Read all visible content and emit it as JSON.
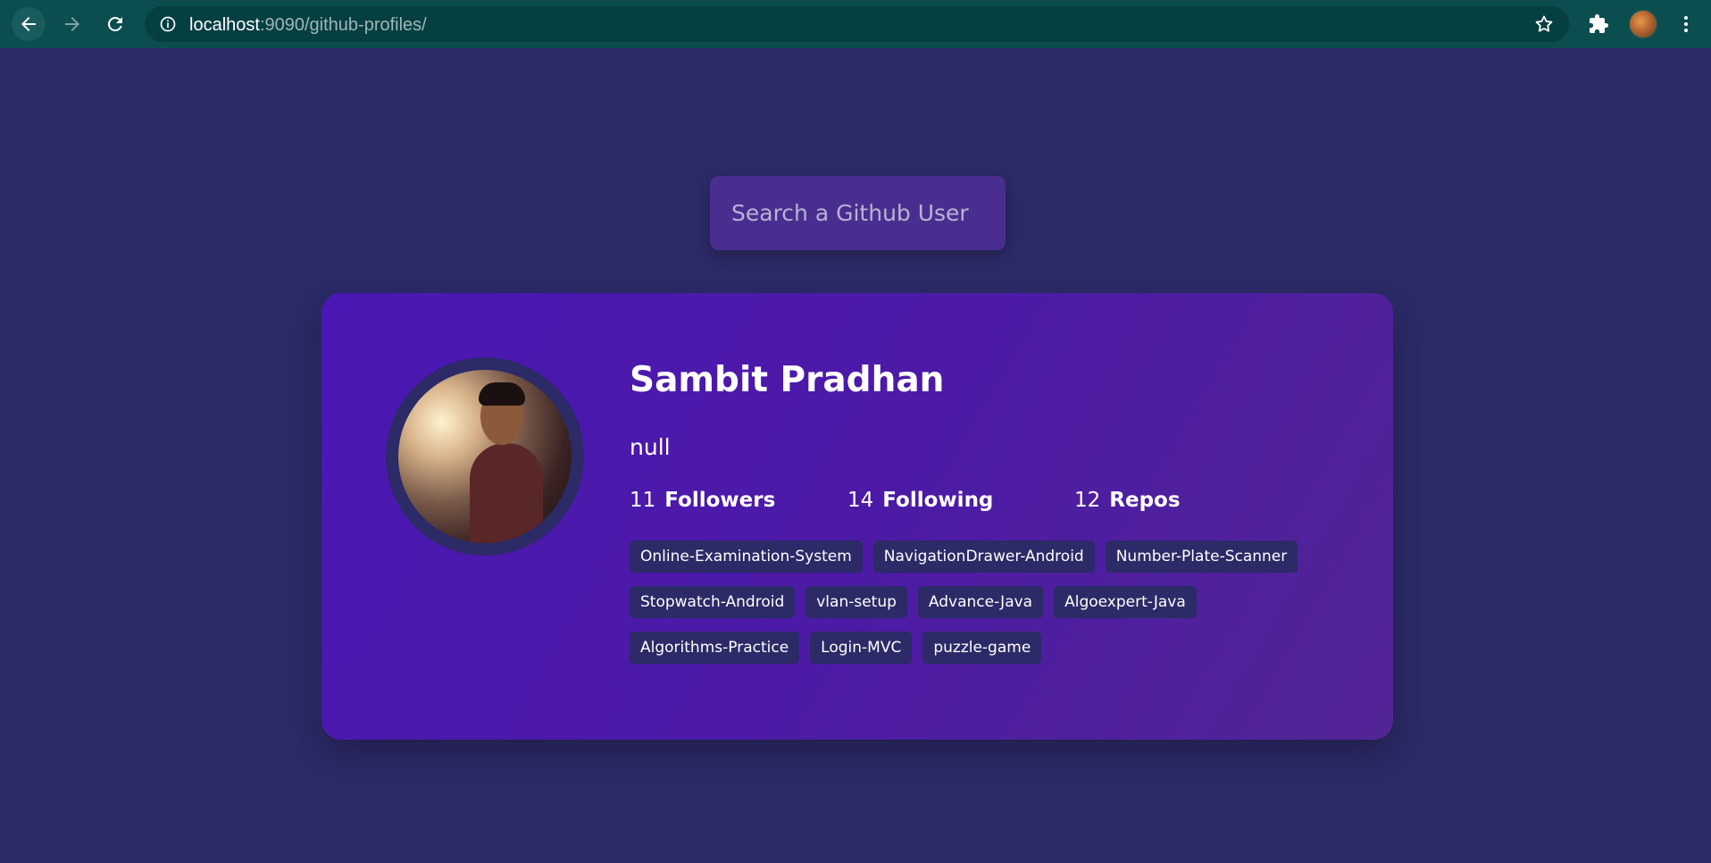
{
  "browser": {
    "url_host": "localhost",
    "url_path": ":9090/github-profiles/"
  },
  "search": {
    "placeholder": "Search a Github User",
    "value": ""
  },
  "profile": {
    "name": "Sambit Pradhan",
    "bio": "null",
    "followers_count": "11",
    "followers_label": "Followers",
    "following_count": "14",
    "following_label": "Following",
    "repos_count": "12",
    "repos_label": "Repos",
    "repos": [
      "Online-Examination-System",
      "NavigationDrawer-Android",
      "Number-Plate-Scanner",
      "Stopwatch-Android",
      "vlan-setup",
      "Advance-Java",
      "Algoexpert-Java",
      "Algorithms-Practice",
      "Login-MVC",
      "puzzle-game"
    ]
  },
  "colors": {
    "page_background": "#2c2a67",
    "card_gradient_start": "#4a17b4",
    "card_gradient_end": "#522596",
    "tag_background": "#2c2a67",
    "search_background": "#4a2e8f",
    "browser_toolbar": "#0c4d4f"
  },
  "icons": [
    "back-arrow-icon",
    "forward-arrow-icon",
    "reload-icon",
    "info-icon",
    "star-icon",
    "puzzle-extension-icon",
    "kebab-menu-icon"
  ]
}
